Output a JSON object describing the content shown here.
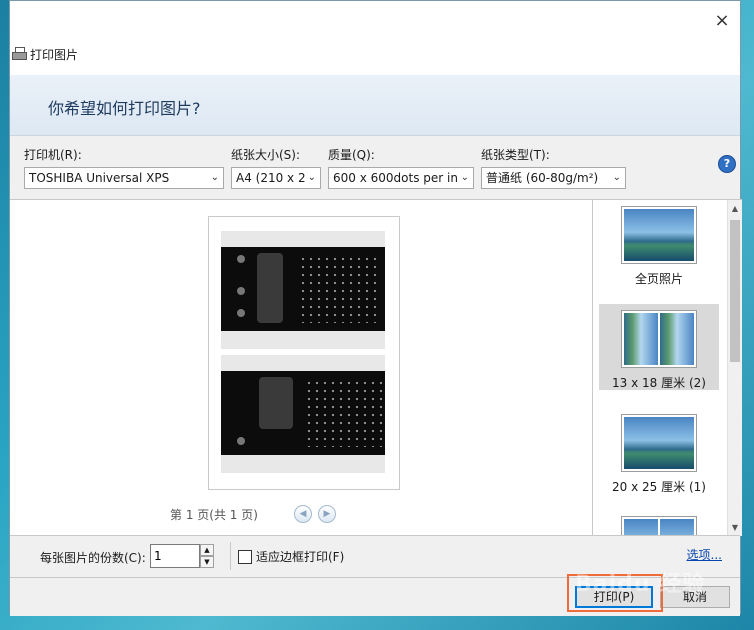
{
  "window": {
    "title": "打印图片",
    "close": "×"
  },
  "header": {
    "question": "你希望如何打印图片?"
  },
  "options": {
    "printer_label": "打印机(R):",
    "printer_value": "TOSHIBA Universal XPS",
    "paper_size_label": "纸张大小(S):",
    "paper_size_value": "A4 (210 x 2",
    "quality_label": "质量(Q):",
    "quality_value": "600 x 600dots per in",
    "paper_type_label": "纸张类型(T):",
    "paper_type_value": "普通纸 (60-80g/m²)",
    "help": "?"
  },
  "preview": {
    "pager": "第 1 页(共 1 页)",
    "prev": "◀",
    "next": "▶"
  },
  "layouts": [
    {
      "label": "全页照片"
    },
    {
      "label": "13 x 18 厘米 (2)"
    },
    {
      "label": "20 x 25 厘米 (1)"
    }
  ],
  "bottom": {
    "copies_label": "每张图片的份数(C):",
    "copies_value": "1",
    "fit_label": "适应边框打印(F)",
    "options_link": "选项..."
  },
  "footer": {
    "print": "打印(P)",
    "cancel": "取消"
  },
  "watermark": "Baidu 经验",
  "colors": {
    "highlight": "#f06b3a",
    "link": "#0645ad"
  }
}
